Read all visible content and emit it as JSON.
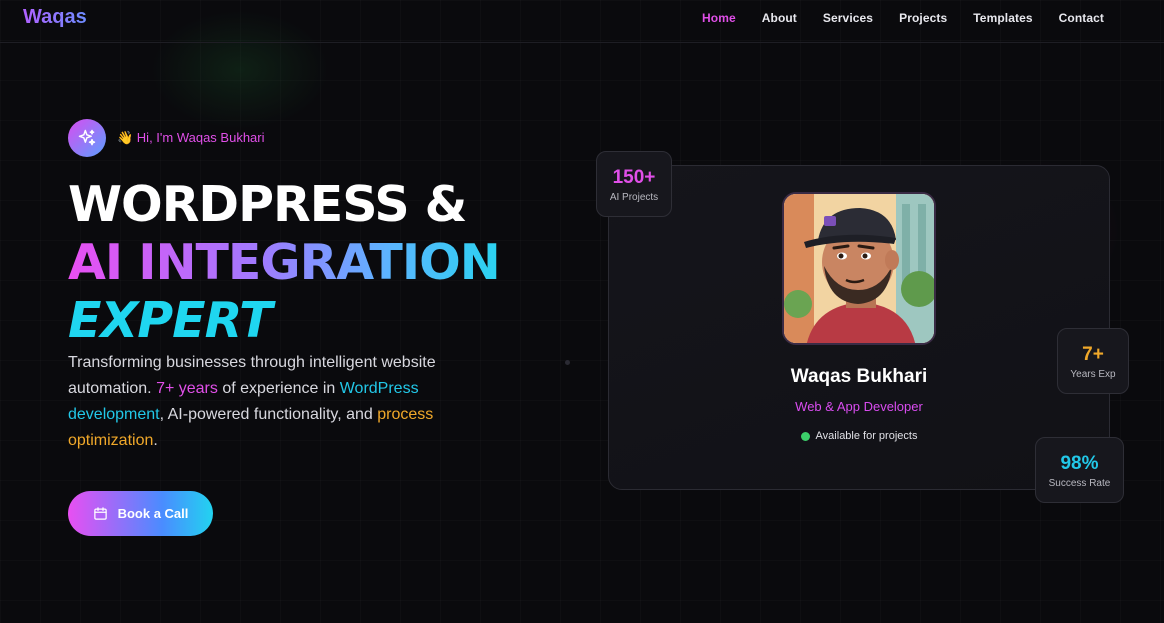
{
  "nav": {
    "logo": "Waqas",
    "links": [
      "Home",
      "About",
      "Services",
      "Projects",
      "Templates",
      "Contact"
    ],
    "active": "Home"
  },
  "hero": {
    "greeting": "👋 Hi, I'm Waqas Bukhari",
    "title_line1": "WORDPRESS &",
    "title_line2": "AI INTEGRATION",
    "title_line3": "EXPERT",
    "desc_part1": "Transforming businesses through intelligent website automation. ",
    "desc_hl1": "7+ years",
    "desc_part2": " of experience in ",
    "desc_hl2": "WordPress development",
    "desc_part3": ", AI-powered functionality, and ",
    "desc_hl3": "process optimization",
    "desc_part4": ".",
    "cta_label": "Book a Call"
  },
  "profile": {
    "name": "Waqas Bukhari",
    "role": "Web & App Developer",
    "status": "Available for projects"
  },
  "stats": {
    "ai_value": "150+",
    "ai_label": "AI Projects",
    "exp_value": "7+",
    "exp_label": "Years Exp",
    "rate_value": "98%",
    "rate_label": "Success Rate"
  },
  "colors": {
    "accent_pink": "#e04fe8",
    "accent_cyan": "#22c8e8",
    "accent_amber": "#f0a82a",
    "status_green": "#3ccf6a"
  }
}
